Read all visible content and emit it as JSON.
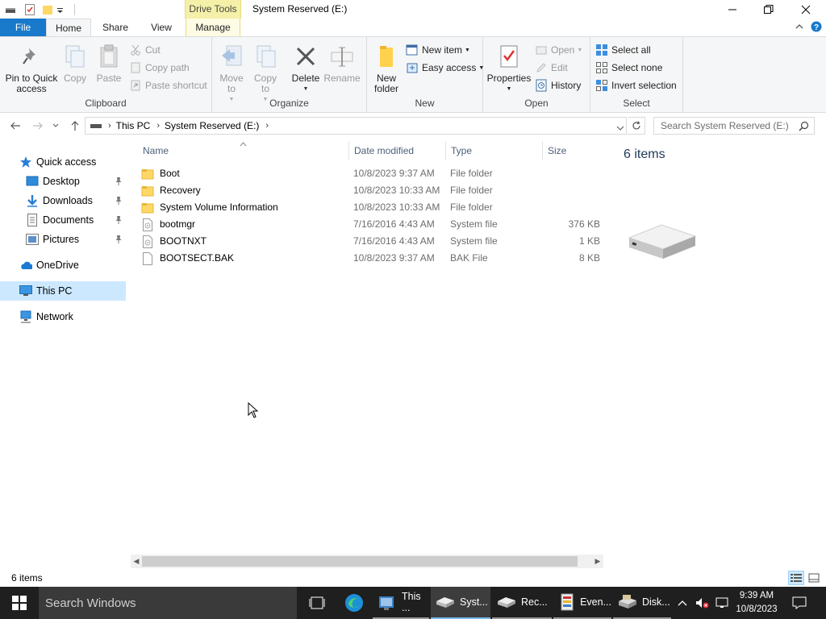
{
  "window": {
    "title": "System Reserved (E:)",
    "context_tab_group": "Drive Tools"
  },
  "ribbon_tabs": {
    "file": "File",
    "home": "Home",
    "share": "Share",
    "view": "View",
    "manage": "Manage"
  },
  "ribbon": {
    "clipboard": {
      "label": "Clipboard",
      "pin_line1": "Pin to Quick",
      "pin_line2": "access",
      "copy": "Copy",
      "paste": "Paste",
      "cut": "Cut",
      "copy_path": "Copy path",
      "paste_shortcut": "Paste shortcut"
    },
    "organize": {
      "label": "Organize",
      "move_line1": "Move",
      "move_line2": "to",
      "copy_line1": "Copy",
      "copy_line2": "to",
      "delete": "Delete",
      "rename": "Rename"
    },
    "new": {
      "label": "New",
      "new_folder_line1": "New",
      "new_folder_line2": "folder",
      "new_item": "New item",
      "easy_access": "Easy access"
    },
    "open": {
      "label": "Open",
      "properties": "Properties",
      "open": "Open",
      "edit": "Edit",
      "history": "History"
    },
    "select": {
      "label": "Select",
      "select_all": "Select all",
      "select_none": "Select none",
      "invert_selection": "Invert selection"
    }
  },
  "address": {
    "crumbs": [
      "This PC",
      "System Reserved (E:)"
    ]
  },
  "search": {
    "placeholder": "Search System Reserved (E:)"
  },
  "nav_pane": {
    "quick_access": "Quick access",
    "desktop": "Desktop",
    "downloads": "Downloads",
    "documents": "Documents",
    "pictures": "Pictures",
    "onedrive": "OneDrive",
    "this_pc": "This PC",
    "network": "Network"
  },
  "columns": {
    "name": "Name",
    "date_modified": "Date modified",
    "type": "Type",
    "size": "Size"
  },
  "files": [
    {
      "name": "Boot",
      "date": "10/8/2023 9:37 AM",
      "type": "File folder",
      "size": "",
      "icon": "folder-icon"
    },
    {
      "name": "Recovery",
      "date": "10/8/2023 10:33 AM",
      "type": "File folder",
      "size": "",
      "icon": "folder-icon"
    },
    {
      "name": "System Volume Information",
      "date": "10/8/2023 10:33 AM",
      "type": "File folder",
      "size": "",
      "icon": "folder-icon"
    },
    {
      "name": "bootmgr",
      "date": "7/16/2016 4:43 AM",
      "type": "System file",
      "size": "376 KB",
      "icon": "system-file-icon"
    },
    {
      "name": "BOOTNXT",
      "date": "7/16/2016 4:43 AM",
      "type": "System file",
      "size": "1 KB",
      "icon": "system-file-icon"
    },
    {
      "name": "BOOTSECT.BAK",
      "date": "10/8/2023 9:37 AM",
      "type": "BAK File",
      "size": "8 KB",
      "icon": "file-icon"
    }
  ],
  "preview": {
    "count": "6 items"
  },
  "status": {
    "items": "6 items"
  },
  "taskbar": {
    "search_placeholder": "Search Windows",
    "buttons": [
      "This ...",
      "Syst...",
      "Rec...",
      "Even...",
      "Disk..."
    ],
    "time": "9:39 AM",
    "date": "10/8/2023"
  },
  "colors": {
    "accent": "#1979ca",
    "selection": "#cce8ff",
    "drive_tools_tab": "#f5f0a8",
    "taskbar": "#1f1f1f"
  }
}
